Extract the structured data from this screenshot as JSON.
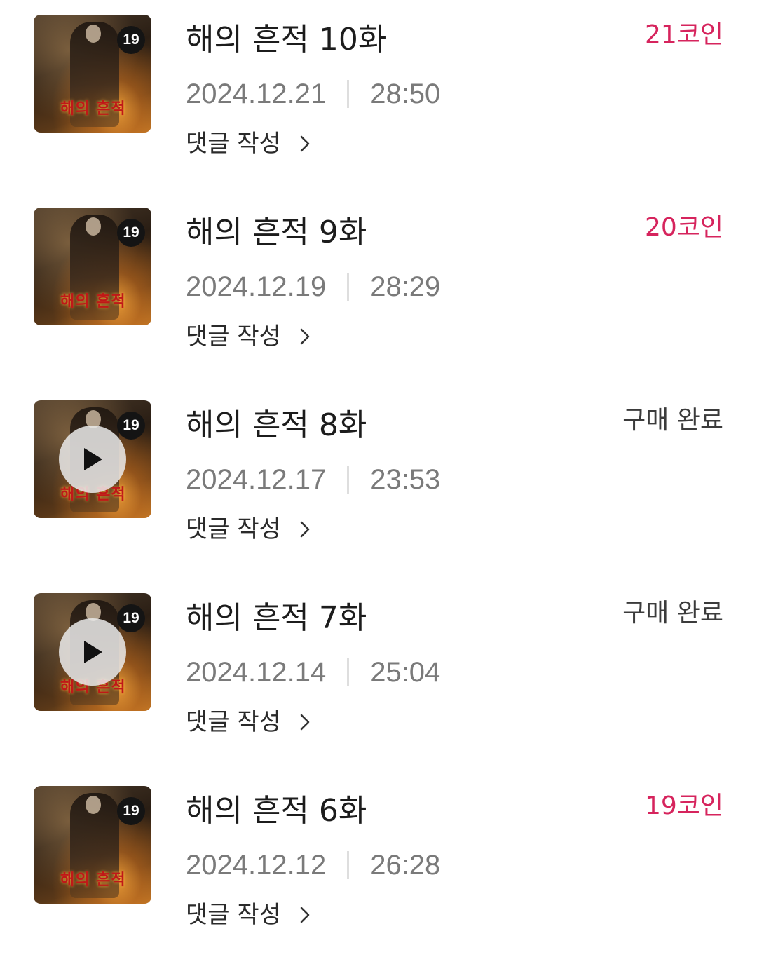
{
  "episodes": [
    {
      "thumbnail_title": "해의 흔적",
      "age_rating": "19",
      "title": "해의 흔적 10화",
      "date": "2024.12.21",
      "duration": "28:50",
      "comment_label": "댓글 작성",
      "status": "21코인",
      "status_type": "coin",
      "show_play": false
    },
    {
      "thumbnail_title": "해의 흔적",
      "age_rating": "19",
      "title": "해의 흔적 9화",
      "date": "2024.12.19",
      "duration": "28:29",
      "comment_label": "댓글 작성",
      "status": "20코인",
      "status_type": "coin",
      "show_play": false
    },
    {
      "thumbnail_title": "해의 흔적",
      "age_rating": "19",
      "title": "해의 흔적 8화",
      "date": "2024.12.17",
      "duration": "23:53",
      "comment_label": "댓글 작성",
      "status": "구매 완료",
      "status_type": "bought",
      "show_play": true
    },
    {
      "thumbnail_title": "해의 흔적",
      "age_rating": "19",
      "title": "해의 흔적 7화",
      "date": "2024.12.14",
      "duration": "25:04",
      "comment_label": "댓글 작성",
      "status": "구매 완료",
      "status_type": "bought",
      "show_play": true
    },
    {
      "thumbnail_title": "해의 흔적",
      "age_rating": "19",
      "title": "해의 흔적 6화",
      "date": "2024.12.12",
      "duration": "26:28",
      "comment_label": "댓글 작성",
      "status": "19코인",
      "status_type": "coin",
      "show_play": false
    }
  ],
  "colors": {
    "coin_price": "#d6245d",
    "bought_status": "#3b3b3b",
    "meta_text": "#7a7a7a"
  },
  "icons": {
    "play": "play-icon",
    "chevron": "chevron-right-icon"
  }
}
